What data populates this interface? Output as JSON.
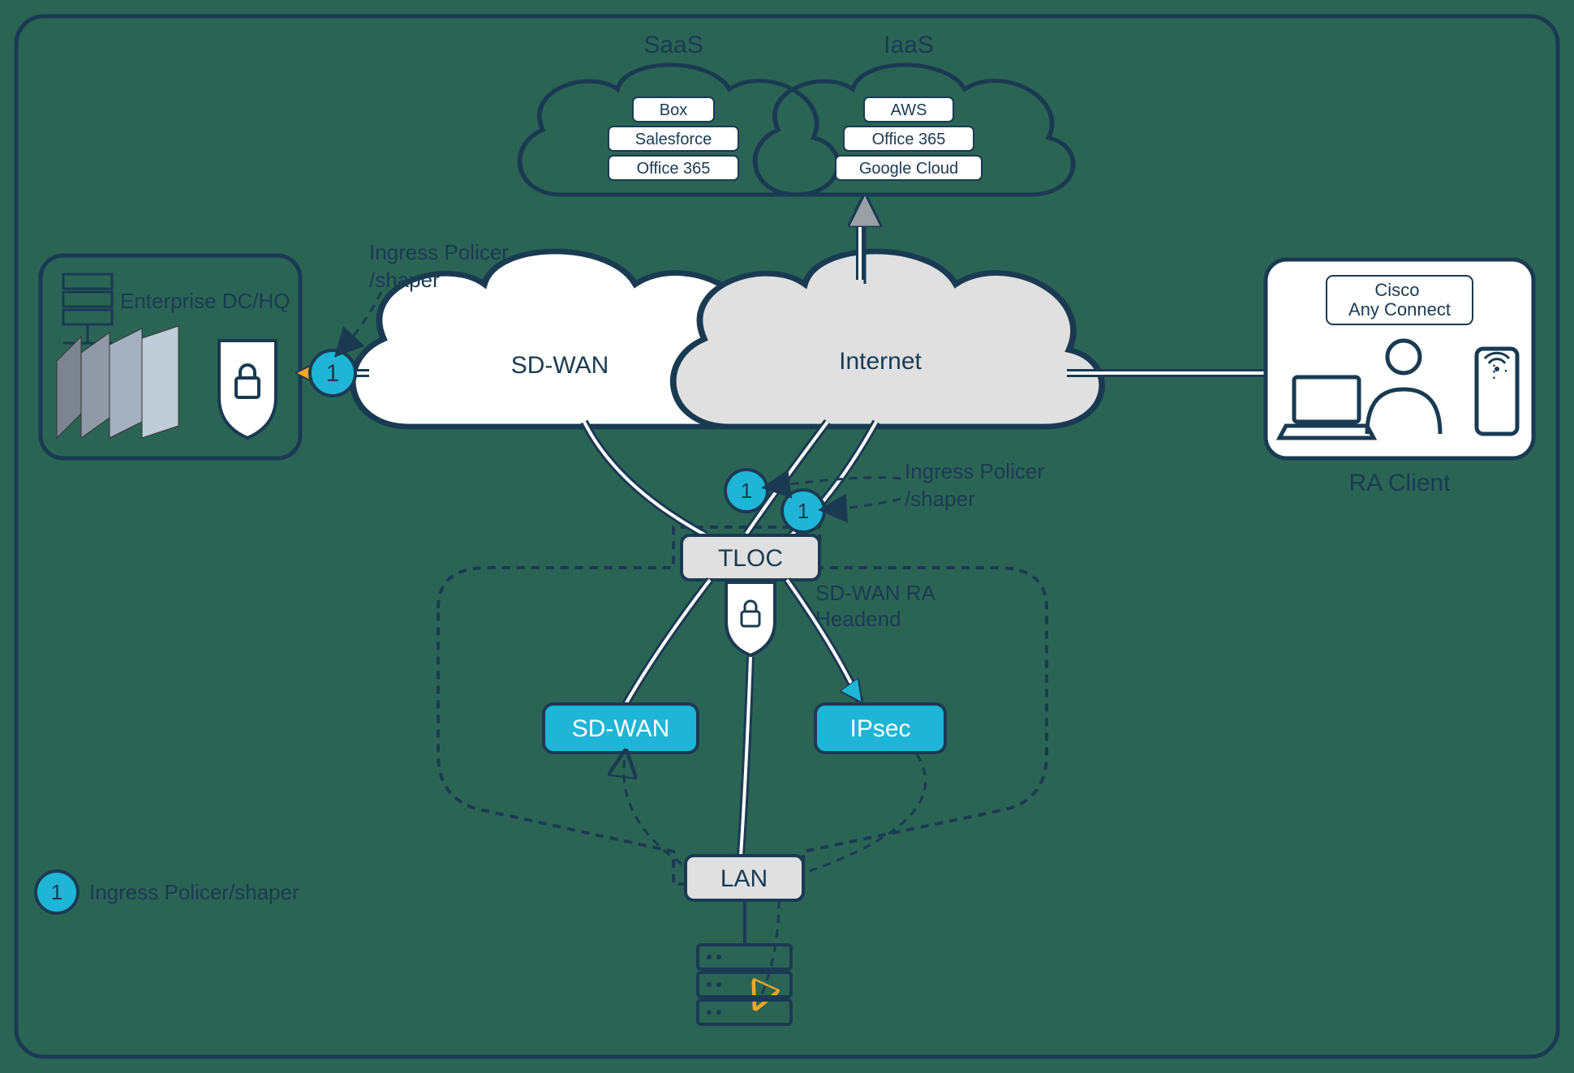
{
  "title": "Enterprise DC/HQ",
  "clouds": {
    "saas": {
      "label": "SaaS",
      "items": [
        "Box",
        "Salesforce",
        "Office 365"
      ]
    },
    "iaas": {
      "label": "IaaS",
      "items": [
        "AWS",
        "Office 365",
        "Google Cloud"
      ]
    },
    "sdwan": "SD-WAN",
    "internet": "Internet"
  },
  "ra_client": {
    "label": "RA Client",
    "banner": "Cisco\nAny Connect"
  },
  "headend": {
    "tloc": "TLOC",
    "label": "SD-WAN RA\nHeadend",
    "sdwan": "SD-WAN",
    "ipsec": "IPsec",
    "lan": "LAN"
  },
  "policer": {
    "text1": "Ingress Policer\n/shaper",
    "text2": "Ingress Policer\n/shaper",
    "legend": "Ingress Policer/shaper",
    "badge": "1"
  }
}
